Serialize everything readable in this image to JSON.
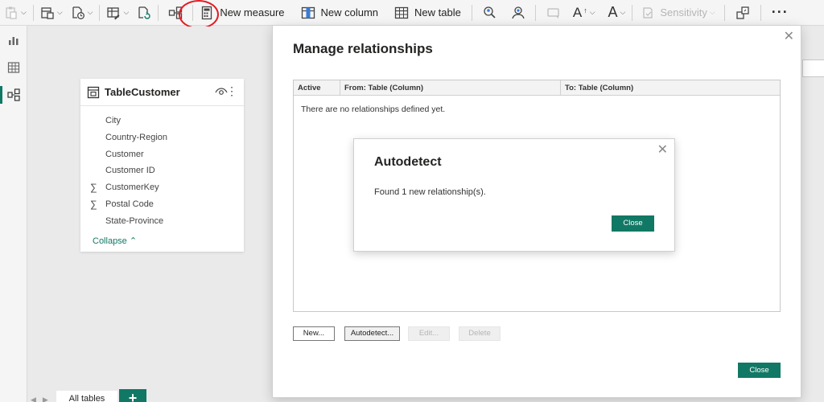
{
  "ribbon": {
    "new_measure": "New measure",
    "new_column": "New column",
    "new_table": "New table",
    "sensitivity": "Sensitivity",
    "more": "···"
  },
  "table_card": {
    "title": "TableCustomer",
    "fields": [
      {
        "name": "City",
        "icon": ""
      },
      {
        "name": "Country-Region",
        "icon": ""
      },
      {
        "name": "Customer",
        "icon": ""
      },
      {
        "name": "Customer ID",
        "icon": ""
      },
      {
        "name": "CustomerKey",
        "icon": "∑"
      },
      {
        "name": "Postal Code",
        "icon": "∑"
      },
      {
        "name": "State-Province",
        "icon": ""
      }
    ],
    "collapse": "Collapse"
  },
  "tabs": {
    "all_tables": "All tables",
    "add": "+"
  },
  "manage_dialog": {
    "title": "Manage relationships",
    "columns": [
      "Active",
      "From: Table (Column)",
      "To: Table (Column)"
    ],
    "empty_message": "There are no relationships defined yet.",
    "buttons": {
      "new": "New...",
      "autodetect": "Autodetect...",
      "edit": "Edit...",
      "delete": "Delete",
      "close": "Close"
    }
  },
  "autodetect_dialog": {
    "title": "Autodetect",
    "message": "Found 1 new relationship(s).",
    "close": "Close"
  },
  "colors": {
    "accent": "#117865",
    "highlight_ring": "#e31b23"
  }
}
